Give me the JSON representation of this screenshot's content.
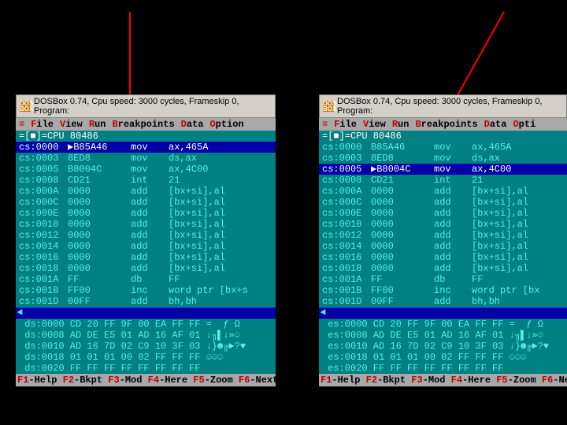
{
  "title": "DOSBox 0.74, Cpu speed:    3000 cycles, Frameskip  0, Program:",
  "menu": [
    {
      "hot": "≡",
      "rest": ""
    },
    {
      "hot": "F",
      "rest": "ile"
    },
    {
      "hot": "V",
      "rest": "iew"
    },
    {
      "hot": "R",
      "rest": "un"
    },
    {
      "hot": "B",
      "rest": "reakpoints"
    },
    {
      "hot": "D",
      "rest": "ata"
    },
    {
      "hot": "O",
      "rest": "ption"
    }
  ],
  "menu_right_last": {
    "hot": "O",
    "rest": "pti"
  },
  "cpu_label": "=[■]=CPU 80486",
  "left": {
    "highlight_index": 0,
    "dump_prefix": "ds",
    "rows": [
      {
        "a": "cs:0000",
        "h": "▶B85A46",
        "m": "mov",
        "o": "ax,465A"
      },
      {
        "a": "cs:0003",
        "h": "8ED8",
        "m": "mov",
        "o": "ds,ax"
      },
      {
        "a": "cs:0005",
        "h": "B8004C",
        "m": "mov",
        "o": "ax,4C00"
      },
      {
        "a": "cs:0008",
        "h": "CD21",
        "m": "int",
        "o": "21"
      },
      {
        "a": "cs:000A",
        "h": "0000",
        "m": "add",
        "o": "[bx+si],al"
      },
      {
        "a": "cs:000C",
        "h": "0000",
        "m": "add",
        "o": "[bx+si],al"
      },
      {
        "a": "cs:000E",
        "h": "0000",
        "m": "add",
        "o": "[bx+si],al"
      },
      {
        "a": "cs:0010",
        "h": "0000",
        "m": "add",
        "o": "[bx+si],al"
      },
      {
        "a": "cs:0012",
        "h": "0000",
        "m": "add",
        "o": "[bx+si],al"
      },
      {
        "a": "cs:0014",
        "h": "0000",
        "m": "add",
        "o": "[bx+si],al"
      },
      {
        "a": "cs:0016",
        "h": "0000",
        "m": "add",
        "o": "[bx+si],al"
      },
      {
        "a": "cs:0018",
        "h": "0000",
        "m": "add",
        "o": "[bx+si],al"
      },
      {
        "a": "cs:001A",
        "h": "FF",
        "m": "db",
        "o": "FF"
      },
      {
        "a": "cs:001B",
        "h": "FF00",
        "m": "inc",
        "o": "word ptr [bx+s"
      },
      {
        "a": "cs:001D",
        "h": "00FF",
        "m": "add",
        "o": "bh,bh"
      }
    ],
    "dump": [
      "ds:0000 CD 20 FF 9F 00 EA FF FF =  ƒ Ω",
      "ds:0008 AD DE E5 01 AD 16 AF 01 ↓╖▌↓»☺",
      "ds:0010 AD 16 7D 02 C9 10 3F 03 ↓}☻╔►?♥",
      "ds:0018 01 01 01 00 02 FF FF FF ☺☺☺",
      "ds:0020 FF FF FF FF FF FF FF FF"
    ]
  },
  "right": {
    "highlight_index": 2,
    "dump_prefix": "es",
    "rows": [
      {
        "a": "cs:0000",
        "h": "B85A46",
        "m": "mov",
        "o": "ax,465A"
      },
      {
        "a": "cs:0003",
        "h": "8ED8",
        "m": "mov",
        "o": "ds,ax"
      },
      {
        "a": "cs:0005",
        "h": "▶B8004C",
        "m": "mov",
        "o": "ax,4C00"
      },
      {
        "a": "cs:0008",
        "h": "CD21",
        "m": "int",
        "o": "21"
      },
      {
        "a": "cs:000A",
        "h": "0000",
        "m": "add",
        "o": "[bx+si],al"
      },
      {
        "a": "cs:000C",
        "h": "0000",
        "m": "add",
        "o": "[bx+si],al"
      },
      {
        "a": "cs:000E",
        "h": "0000",
        "m": "add",
        "o": "[bx+si],al"
      },
      {
        "a": "cs:0010",
        "h": "0000",
        "m": "add",
        "o": "[bx+si],al"
      },
      {
        "a": "cs:0012",
        "h": "0000",
        "m": "add",
        "o": "[bx+si],al"
      },
      {
        "a": "cs:0014",
        "h": "0000",
        "m": "add",
        "o": "[bx+si],al"
      },
      {
        "a": "cs:0016",
        "h": "0000",
        "m": "add",
        "o": "[bx+si],al"
      },
      {
        "a": "cs:0018",
        "h": "0000",
        "m": "add",
        "o": "[bx+si],al"
      },
      {
        "a": "cs:001A",
        "h": "FF",
        "m": "db",
        "o": "FF"
      },
      {
        "a": "cs:001B",
        "h": "FF00",
        "m": "inc",
        "o": "word ptr [bx"
      },
      {
        "a": "cs:001D",
        "h": "00FF",
        "m": "add",
        "o": "bh,bh"
      }
    ],
    "dump": [
      "es:0000 CD 20 FF 9F 00 EA FF FF =  ƒ Ω",
      "es:0008 AD DE E5 01 AD 16 AF 01 ↓╖▌↓»☺",
      "es:0010 AD 16 7D 02 C9 10 3F 03 ↓}☻╔►?♥",
      "es:0018 01 01 01 00 02 FF FF FF ☺☺☺",
      "es:0020 FF FF FF FF FF FF FF FF"
    ]
  },
  "fkeys": [
    {
      "k": "F1",
      "t": "-Help "
    },
    {
      "k": "F2",
      "t": "-Bkpt "
    },
    {
      "k": "F3",
      "t": "-Mod "
    },
    {
      "k": "F4",
      "t": "-Here "
    },
    {
      "k": "F5",
      "t": "-Zoom "
    },
    {
      "k": "F6",
      "t": "-Next"
    }
  ],
  "fkeys_right_last": {
    "k": "F6",
    "t": "-Ne"
  }
}
